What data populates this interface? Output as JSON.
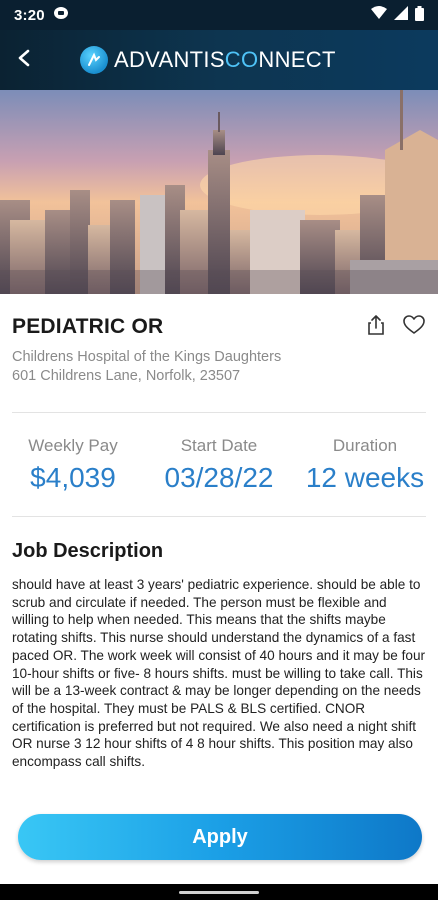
{
  "status_bar": {
    "time": "3:20"
  },
  "app": {
    "logo_part1": "ADVANTIS",
    "logo_part2_c": "C",
    "logo_part2_o": "O",
    "logo_part2_rest": "NNECT"
  },
  "job": {
    "title": "PEDIATRIC OR",
    "facility": "Childrens Hospital of the Kings Daughters",
    "address": "601 Childrens Lane, Norfolk,   23507"
  },
  "stats": [
    {
      "label": "Weekly Pay",
      "value": "$4,039"
    },
    {
      "label": "Start Date",
      "value": "03/28/22"
    },
    {
      "label": "Duration",
      "value": "12 weeks"
    }
  ],
  "description": {
    "heading": "Job Description",
    "body": "should have at least 3 years' pediatric experience.  should be able to scrub and circulate if needed. The person must be flexible and willing to help when needed. This means that the shifts maybe rotating shifts. This nurse should understand the dynamics of a fast paced OR. The work week will consist of 40 hours and it may be four 10-hour shifts or five- 8 hours shifts. must be willing to take call. This will be a 13-week contract & may be longer depending on the needs of the hospital. They must be PALS & BLS certified. CNOR certification is preferred but not required. We also need a night shift OR nurse 3 12 hour shifts of 4 8 hour shifts. This position may also encompass call shifts."
  },
  "actions": {
    "apply_label": "Apply"
  },
  "colors": {
    "accent": "#2a7fc9",
    "header": "#0c2d44",
    "button": "#1b9fe6"
  },
  "icons": [
    "back-arrow-icon",
    "share-icon",
    "heart-icon",
    "wifi-icon",
    "signal-icon",
    "battery-icon"
  ]
}
